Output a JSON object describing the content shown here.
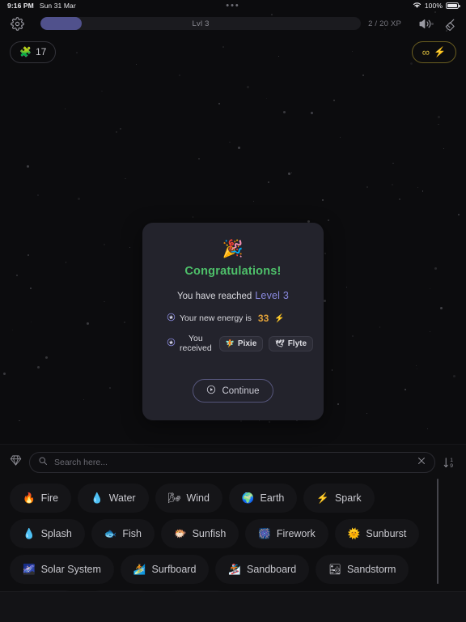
{
  "statusbar": {
    "time": "9:16 PM",
    "date": "Sun 31 Mar",
    "center_dots": "•••",
    "battery_pct": "100%",
    "wifi_icon": "wifi-icon",
    "battery_icon": "battery-icon"
  },
  "topbar": {
    "settings_icon": "gear-icon",
    "xp": {
      "level_label": "Lvl 3",
      "xp_text": "2 / 20 XP",
      "fill_percent": 13,
      "fill_color": "#50518c",
      "track_color": "#1b1b1f"
    },
    "sound_icon": "speaker-icon",
    "broom_icon": "broom-icon"
  },
  "badges": {
    "pieces": {
      "icon": "puzzle-piece-icon",
      "emoji": "🧩",
      "value": "17"
    },
    "energy": {
      "icon": "infinity-bolt-icon",
      "infinity": "∞",
      "bolt": "⚡",
      "color": "#d7b93c"
    }
  },
  "modal": {
    "party_emoji": "🎉",
    "title": "Congratulations!",
    "title_color": "#4ec06a",
    "reached_prefix": "You have reached",
    "reached_level": "Level 3",
    "level_color": "#8a8ae0",
    "energy_line": {
      "bullet_icon": "star-circle-icon",
      "text": "Your new energy is",
      "value": "33",
      "value_color": "#e0a13a",
      "bolt": "⚡"
    },
    "received_line": {
      "bullet_icon": "star-circle-icon",
      "text": "You received",
      "items": [
        {
          "emoji": "🧚",
          "label": "Pixie"
        },
        {
          "emoji": "🕊",
          "label": "Flyte"
        }
      ]
    },
    "continue": {
      "icon": "play-circle-icon",
      "label": "Continue"
    }
  },
  "sheet": {
    "gem_icon": "diamond-icon",
    "search": {
      "icon": "search-icon",
      "placeholder": "Search here...",
      "value": "",
      "clear_icon": "close-icon"
    },
    "sort": {
      "icon": "sort-one-nine-icon",
      "top": "1",
      "bottom": "9"
    },
    "rows": [
      [
        {
          "emoji": "🔥",
          "label": "Fire"
        },
        {
          "emoji": "💧",
          "label": "Water"
        },
        {
          "emoji": "🌬",
          "label": "Wind"
        },
        {
          "emoji": "🌍",
          "label": "Earth"
        },
        {
          "emoji": "⚡",
          "label": "Spark"
        }
      ],
      [
        {
          "emoji": "💧",
          "label": "Splash"
        },
        {
          "emoji": "🐟",
          "label": "Fish"
        },
        {
          "emoji": "🐡",
          "label": "Sunfish"
        },
        {
          "emoji": "🎆",
          "label": "Firework"
        },
        {
          "emoji": "🌞",
          "label": "Sunburst"
        }
      ],
      [
        {
          "emoji": "🌌",
          "label": "Solar System"
        },
        {
          "emoji": "🏄",
          "label": "Surfboard"
        },
        {
          "emoji": "🏂",
          "label": "Sandboard"
        },
        {
          "emoji": "🏜",
          "label": "Sandstorm"
        }
      ]
    ]
  }
}
